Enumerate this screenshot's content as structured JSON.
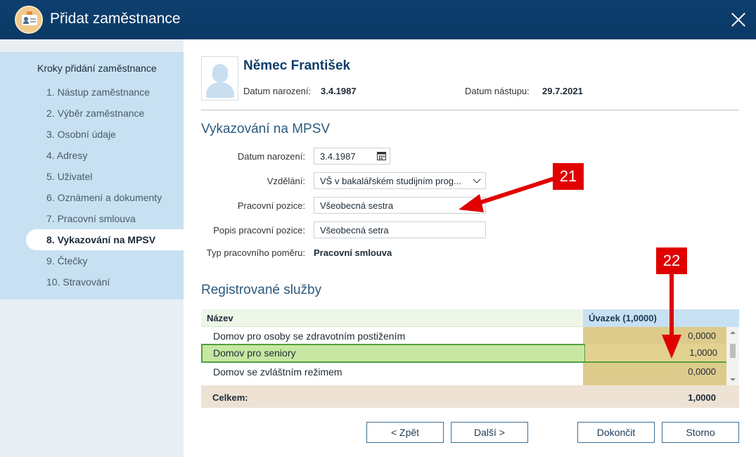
{
  "window": {
    "title": "Přidat zaměstnance"
  },
  "sidebar": {
    "heading": "Kroky přidání zaměstnance",
    "steps": [
      "1. Nástup zaměstnance",
      "2. Výběr zaměstnance",
      "3. Osobní údaje",
      "4. Adresy",
      "5. Uživatel",
      "6. Oznámení a dokumenty",
      "7. Pracovní smlouva",
      "8. Vykazování na MPSV",
      "9. Čtečky",
      "10. Stravování"
    ],
    "active_step": "8. Vykazování na MPSV"
  },
  "header": {
    "name": "Němec František",
    "birth_label": "Datum narození:",
    "birth_value": "3.4.1987",
    "start_label": "Datum nástupu:",
    "start_value": "29.7.2021"
  },
  "mpsv": {
    "title": "Vykazování na MPSV",
    "birth_label": "Datum narození:",
    "birth_value": "3.4.1987",
    "education_label": "Vzdělání:",
    "education_value": "VŠ v bakalářském studijním prog...",
    "position_label": "Pracovní pozice:",
    "position_value": "Všeobecná sestra",
    "position_desc_label": "Popis pracovní pozice:",
    "position_desc_value": "Všeobecná setra",
    "contract_type_label": "Typ pracovního poměru:",
    "contract_type_value": "Pracovní smlouva"
  },
  "services": {
    "title": "Registrované služby",
    "col_name": "Název",
    "col_workload": "Úvazek (1,0000)",
    "rows": [
      {
        "name": "Domov pro osoby se zdravotním postižením",
        "workload": "0,0000"
      },
      {
        "name": "Domov pro seniory",
        "workload": "1,0000"
      },
      {
        "name": "Domov se zvláštním režimem",
        "workload": "0,0000"
      }
    ],
    "total_label": "Celkem:",
    "total_value": "1,0000"
  },
  "buttons": {
    "back": "< Zpět",
    "next": "Další >",
    "finish": "Dokončit",
    "cancel": "Storno"
  },
  "annotations": {
    "callout_1": "21",
    "callout_2": "22"
  },
  "colors": {
    "titlebar": "#0b3966",
    "sidebar_panel": "#c7e1f2",
    "selected_row": "#c7e7a2",
    "workload_cell": "#ddcb8c",
    "callout": "#e00000"
  }
}
